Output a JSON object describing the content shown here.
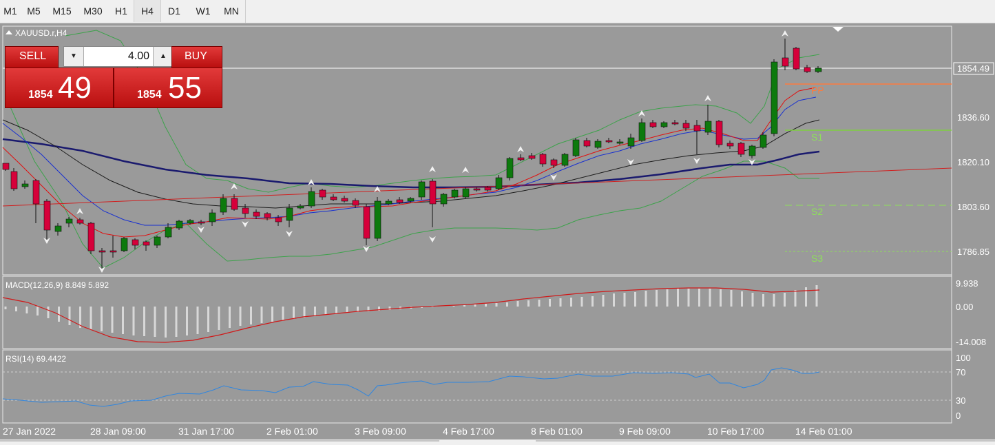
{
  "timeframes": [
    {
      "label": "M1",
      "selected": false
    },
    {
      "label": "M5",
      "selected": false
    },
    {
      "label": "M15",
      "selected": false
    },
    {
      "label": "M30",
      "selected": false
    },
    {
      "label": "H1",
      "selected": false
    },
    {
      "label": "H4",
      "selected": true
    },
    {
      "label": "D1",
      "selected": false
    },
    {
      "label": "W1",
      "selected": false
    },
    {
      "label": "MN",
      "selected": false
    }
  ],
  "symbol_label": "XAUUSD.r,H4",
  "trade_panel": {
    "sell_label": "SELL",
    "buy_label": "BUY",
    "volume": "4.00",
    "sell_big": "1854",
    "sell_small": "49",
    "buy_big": "1854",
    "buy_small": "55"
  },
  "price_axis": {
    "ticks": [
      "1836.60",
      "1820.10",
      "1803.60",
      "1786.85"
    ],
    "current": "1854.49"
  },
  "pivots": {
    "pp": "PP",
    "s1": "S1",
    "s2": "S2",
    "s3": "S3"
  },
  "macd": {
    "label": "MACD(12,26,9) 8.849 5.892",
    "ticks": [
      "9.938",
      "0.00",
      "-14.008"
    ]
  },
  "rsi": {
    "label": "RSI(14) 69.4422",
    "ticks": [
      "100",
      "70",
      "30",
      "0"
    ]
  },
  "time_axis": [
    "27 Jan 2022",
    "28 Jan 09:00",
    "31 Jan 17:00",
    "2 Feb 01:00",
    "3 Feb 09:00",
    "4 Feb 17:00",
    "8 Feb 01:00",
    "9 Feb 09:00",
    "10 Feb 17:00",
    "14 Feb 01:00"
  ],
  "colors": {
    "background": "#9a9a9a",
    "bull": "#0d7a0d",
    "bear": "#d6003a",
    "ma_fast": "#e01010",
    "ma_mid": "#1830d0",
    "ma_slow": "#1b1b1b",
    "ma_long": "#1a1a6e",
    "bands": "#3ca24a",
    "pivot_pp": "#ff7a3c",
    "pivot_s": "#8ee05a",
    "rsi_line": "#2f86e0"
  }
}
